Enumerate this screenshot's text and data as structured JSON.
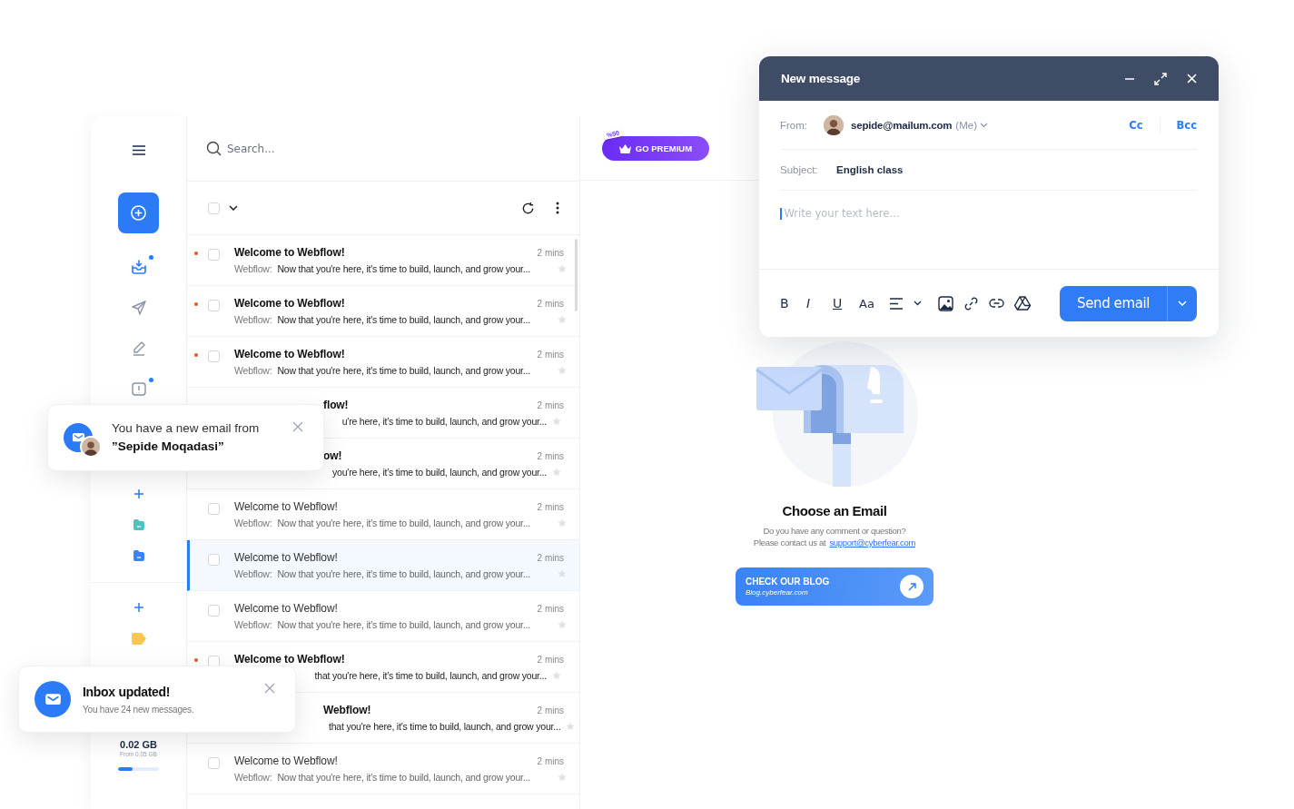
{
  "sidebar": {
    "nav": [
      {
        "kind": "inbox",
        "selected": true,
        "badge": true
      },
      {
        "kind": "send",
        "selected": false,
        "badge": false
      },
      {
        "kind": "draft",
        "selected": false,
        "badge": false
      },
      {
        "kind": "alert",
        "selected": false,
        "badge": true
      }
    ],
    "folders": [
      {
        "color": "#4cc3c0"
      },
      {
        "color": "#3b82f6"
      }
    ],
    "labels": [
      {
        "color": "#f9c74f"
      }
    ],
    "storage": {
      "used": "0.02 GB",
      "total": "From 0.05 GB",
      "level": 0.35
    }
  },
  "search": {
    "placeholder": "Search..."
  },
  "list_toolbar": {
    "select_all_checked": false
  },
  "emails": [
    {
      "kind": "full",
      "subject": "Welcome to Webflow!",
      "sender": "Webflow:",
      "preview": "Now that you're here, it's time to build, launch, and grow your...",
      "time": "2 mins",
      "unread": true,
      "selected": false,
      "checked": false
    },
    {
      "kind": "full",
      "subject": "Welcome to Webflow!",
      "sender": "Webflow:",
      "preview": "Now that you're here, it's time to build, launch, and grow your...",
      "time": "2 mins",
      "unread": true,
      "selected": false,
      "checked": false
    },
    {
      "kind": "full",
      "subject": "Welcome to Webflow!",
      "sender": "Webflow:",
      "preview": "Now that you're here, it's time to build, launch, and grow your...",
      "time": "2 mins",
      "unread": true,
      "selected": false,
      "checked": false
    },
    {
      "kind": "clipped",
      "subject": "flow!",
      "preview": "u're here, it's time to build, launch, and grow your...",
      "time": "2 mins",
      "unread": true,
      "selected": false
    },
    {
      "kind": "clipped",
      "subject": "ow!",
      "preview": "you're here, it's time to build, launch, and grow your...",
      "time": "2 mins",
      "unread": true,
      "selected": false
    },
    {
      "kind": "full",
      "subject": "Welcome to Webflow!",
      "sender": "Webflow:",
      "preview": "Now that you're here, it's time to build, launch, and grow your...",
      "time": "2 mins",
      "unread": false,
      "selected": false,
      "checked": false
    },
    {
      "kind": "full",
      "subject": "Welcome to Webflow!",
      "sender": "Webflow:",
      "preview": "Now that you're here, it's time to build, launch, and grow your...",
      "time": "2 mins",
      "unread": false,
      "selected": true,
      "checked": false
    },
    {
      "kind": "full",
      "subject": "Welcome to Webflow!",
      "sender": "Webflow:",
      "preview": "Now that you're here, it's time to build, launch, and grow your...",
      "time": "2 mins",
      "unread": false,
      "selected": false,
      "checked": false
    },
    {
      "kind": "full",
      "subject": "Welcome to Webflow!",
      "preview": "that you're here, it's time to build, launch, and grow your...",
      "time": "2 mins",
      "unread": true,
      "selected": false,
      "checked": false
    },
    {
      "kind": "clipped",
      "subject": "Webflow!",
      "preview": "that you're here, it's time to build, launch, and grow your...",
      "time": "2 mins",
      "unread": true,
      "selected": false
    },
    {
      "kind": "full",
      "subject": "Welcome to Webflow!",
      "sender": "Webflow:",
      "preview": "Now that you're here, it's time to build, launch, and grow your...",
      "time": "2 mins",
      "unread": false,
      "selected": false,
      "checked": false
    }
  ],
  "premium": {
    "tag": "%50",
    "label": "GO PREMIUM"
  },
  "empty_state": {
    "title": "Choose an Email",
    "line_1": "Do you have any comment or question?",
    "line_2": "Please contact us at",
    "link": "support@cyberfear.com",
    "blog_title": "CHECK OUR BLOG",
    "blog_url": "Blog.cyberfear.com"
  },
  "compose": {
    "title": "New message",
    "from_label": "From:",
    "from_address": "sepide@mailum.com",
    "from_suffix": "(Me)",
    "cc": "Cc",
    "bcc": "Bcc",
    "subject_label": "Subject:",
    "subject": "English class",
    "body_placeholder": "Write your text here…",
    "format_buttons": [
      "B",
      "I",
      "U",
      "Aa"
    ],
    "send": "Send email"
  },
  "toasts": [
    {
      "kind": "sender",
      "message": "You have a new email from **”Sepide Moqadasi”**"
    },
    {
      "kind": "info",
      "title": "Inbox updated!",
      "message": "You have 24 new messages."
    }
  ]
}
